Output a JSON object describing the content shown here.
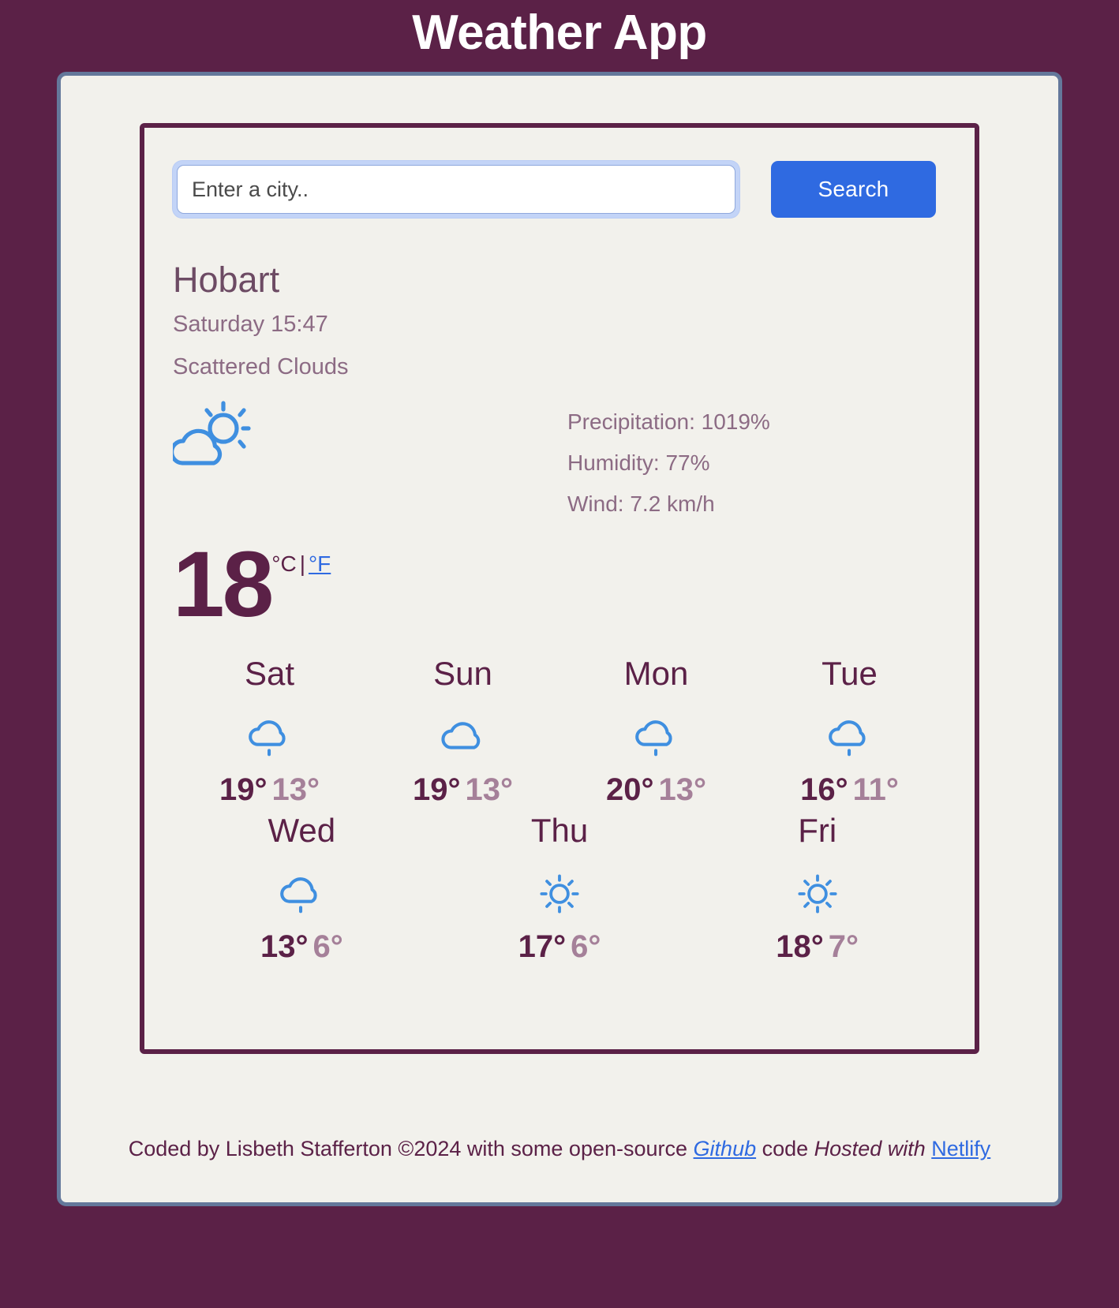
{
  "app": {
    "title": "Weather App",
    "background_color": "#5b2147",
    "card_background": "#f2f1ec",
    "card_border_color": "#64789b",
    "accent_link_color": "#2f6ae1",
    "icon_color": "#3f8fe0"
  },
  "search": {
    "placeholder": "Enter a city..",
    "value": "",
    "button_label": "Search"
  },
  "current": {
    "city": "Hobart",
    "datetime": "Saturday 15:47",
    "condition": "Scattered Clouds",
    "icon": "sun-behind-cloud-icon",
    "temperature": "18",
    "unit_celsius": "°C",
    "unit_separator": "|",
    "unit_fahrenheit": "°F",
    "details": [
      {
        "name": "precipitation",
        "text": "Precipitation: 1019%"
      },
      {
        "name": "humidity",
        "text": "Humidity: 77%"
      },
      {
        "name": "wind",
        "text": "Wind: 7.2 km/h"
      }
    ]
  },
  "forecast": {
    "row1": [
      {
        "day": "Sat",
        "icon": "rain-cloud-icon",
        "max": "19°",
        "min": "13°"
      },
      {
        "day": "Sun",
        "icon": "cloud-icon",
        "max": "19°",
        "min": "13°"
      },
      {
        "day": "Mon",
        "icon": "rain-cloud-icon",
        "max": "20°",
        "min": "13°"
      },
      {
        "day": "Tue",
        "icon": "rain-cloud-icon",
        "max": "16°",
        "min": "11°"
      }
    ],
    "row2": [
      {
        "day": "Wed",
        "icon": "rain-cloud-icon",
        "max": "13°",
        "min": "6°"
      },
      {
        "day": "Thu",
        "icon": "sun-icon",
        "max": "17°",
        "min": "6°"
      },
      {
        "day": "Fri",
        "icon": "sun-icon",
        "max": "18°",
        "min": "7°"
      }
    ]
  },
  "footer": {
    "text_before_github": "Coded by Lisbeth Stafferton ©2024 with some open-source ",
    "github_label": "Github",
    "text_after_github": " code ",
    "hosted_with": "Hosted with",
    "netlify_label": "Netlify"
  }
}
